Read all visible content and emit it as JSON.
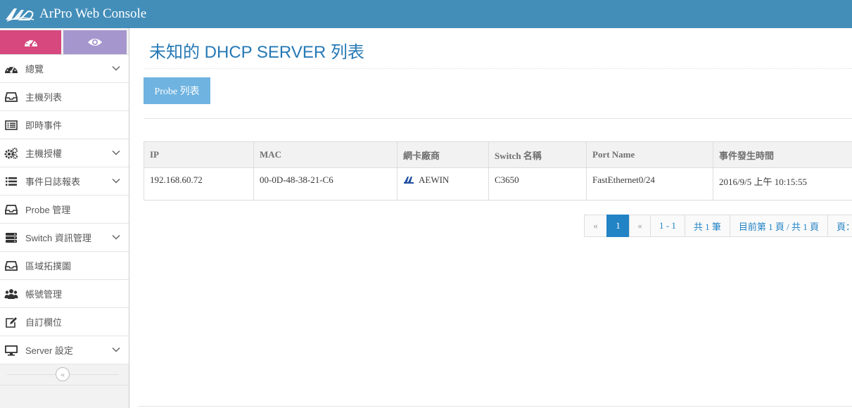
{
  "app": {
    "title": "ArPro Web Console"
  },
  "colors": {
    "navbar": "#438eb9",
    "shortcut_pink": "#d6487e",
    "shortcut_purple": "#a696ce",
    "accent": "#2283c5",
    "probe_button": "#6fb3e0"
  },
  "sidebar": {
    "shortcuts": [
      {
        "icon": "dashboard-icon"
      },
      {
        "icon": "eye-icon"
      }
    ],
    "items": [
      {
        "label": "總覽",
        "icon": "dashboard-icon",
        "expandable": true
      },
      {
        "label": "主機列表",
        "icon": "inbox-icon",
        "expandable": false
      },
      {
        "label": "即時事件",
        "icon": "list-alt-icon",
        "expandable": false
      },
      {
        "label": "主機授權",
        "icon": "cogs-icon",
        "expandable": true
      },
      {
        "label": "事件日誌報表",
        "icon": "list-icon",
        "expandable": true
      },
      {
        "label": "Probe 管理",
        "icon": "inbox-icon",
        "expandable": false
      },
      {
        "label": "Switch 資訊管理",
        "icon": "server-icon",
        "expandable": true
      },
      {
        "label": "區域拓撲圖",
        "icon": "inbox-icon",
        "expandable": false
      },
      {
        "label": "帳號管理",
        "icon": "users-icon",
        "expandable": false
      },
      {
        "label": "自訂欄位",
        "icon": "edit-icon",
        "expandable": false
      },
      {
        "label": "Server 設定",
        "icon": "desktop-icon",
        "expandable": true
      }
    ],
    "collapse_glyph": "«"
  },
  "main": {
    "title": "未知的 DHCP SERVER 列表",
    "probe_button": "Probe 列表",
    "table": {
      "headers": [
        "IP",
        "MAC",
        "網卡廠商",
        "Switch 名稱",
        "Port Name",
        "事件發生時間"
      ],
      "rows": [
        {
          "ip": "192.168.60.72",
          "mac": "00-0D-48-38-21-C6",
          "vendor": "AEWIN",
          "switch": "C3650",
          "port": "FastEthernet0/24",
          "time": "2016/9/5 上午 10:15:55"
        }
      ]
    },
    "pagination": {
      "first": "«",
      "current": "1",
      "prev": "«",
      "range": "1 - 1",
      "total": "共 1 筆",
      "page_info": "目前第 1 頁 / 共 1 頁",
      "page_label": "頁："
    }
  }
}
